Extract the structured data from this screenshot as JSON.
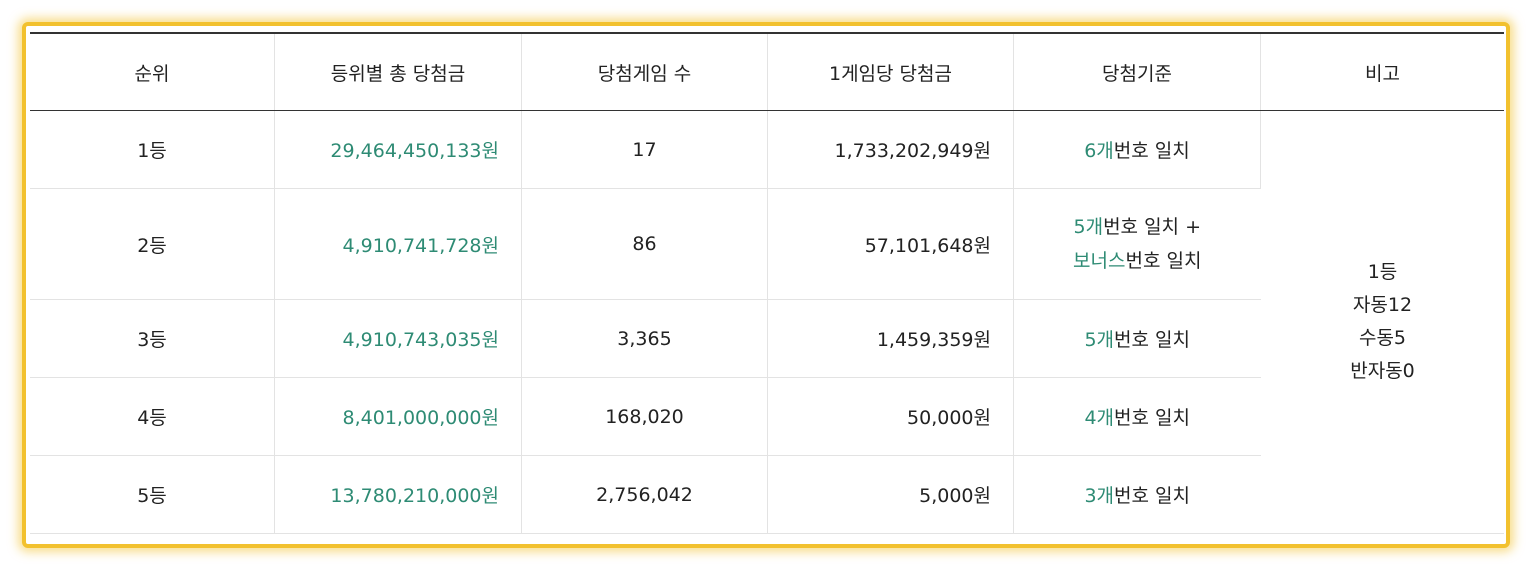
{
  "headers": [
    "순위",
    "등위별 총 당첨금",
    "당첨게임 수",
    "1게임당 당첨금",
    "당첨기준",
    "비고"
  ],
  "rows": [
    {
      "rank": "1등",
      "total": "29,464,450,133원",
      "games": "17",
      "per_game": "1,733,202,949원",
      "crit1_num": "6개",
      "crit1_text": "번호 일치"
    },
    {
      "rank": "2등",
      "total": "4,910,741,728원",
      "games": "86",
      "per_game": "57,101,648원",
      "crit1_num": "5개",
      "crit1_text": "번호 일치 +",
      "crit2_num": "보너스",
      "crit2_text": "번호 일치"
    },
    {
      "rank": "3등",
      "total": "4,910,743,035원",
      "games": "3,365",
      "per_game": "1,459,359원",
      "crit1_num": "5개",
      "crit1_text": "번호 일치"
    },
    {
      "rank": "4등",
      "total": "8,401,000,000원",
      "games": "168,020",
      "per_game": "50,000원",
      "crit1_num": "4개",
      "crit1_text": "번호 일치"
    },
    {
      "rank": "5등",
      "total": "13,780,210,000원",
      "games": "2,756,042",
      "per_game": "5,000원",
      "crit1_num": "3개",
      "crit1_text": "번호 일치"
    }
  ],
  "note": {
    "line1": "1등",
    "line2": "자동12",
    "line3": "수동5",
    "line4": "반자동0"
  },
  "colors": {
    "accent_green": "#2e8b74",
    "frame_border": "#f2c12e",
    "text": "#222222"
  }
}
